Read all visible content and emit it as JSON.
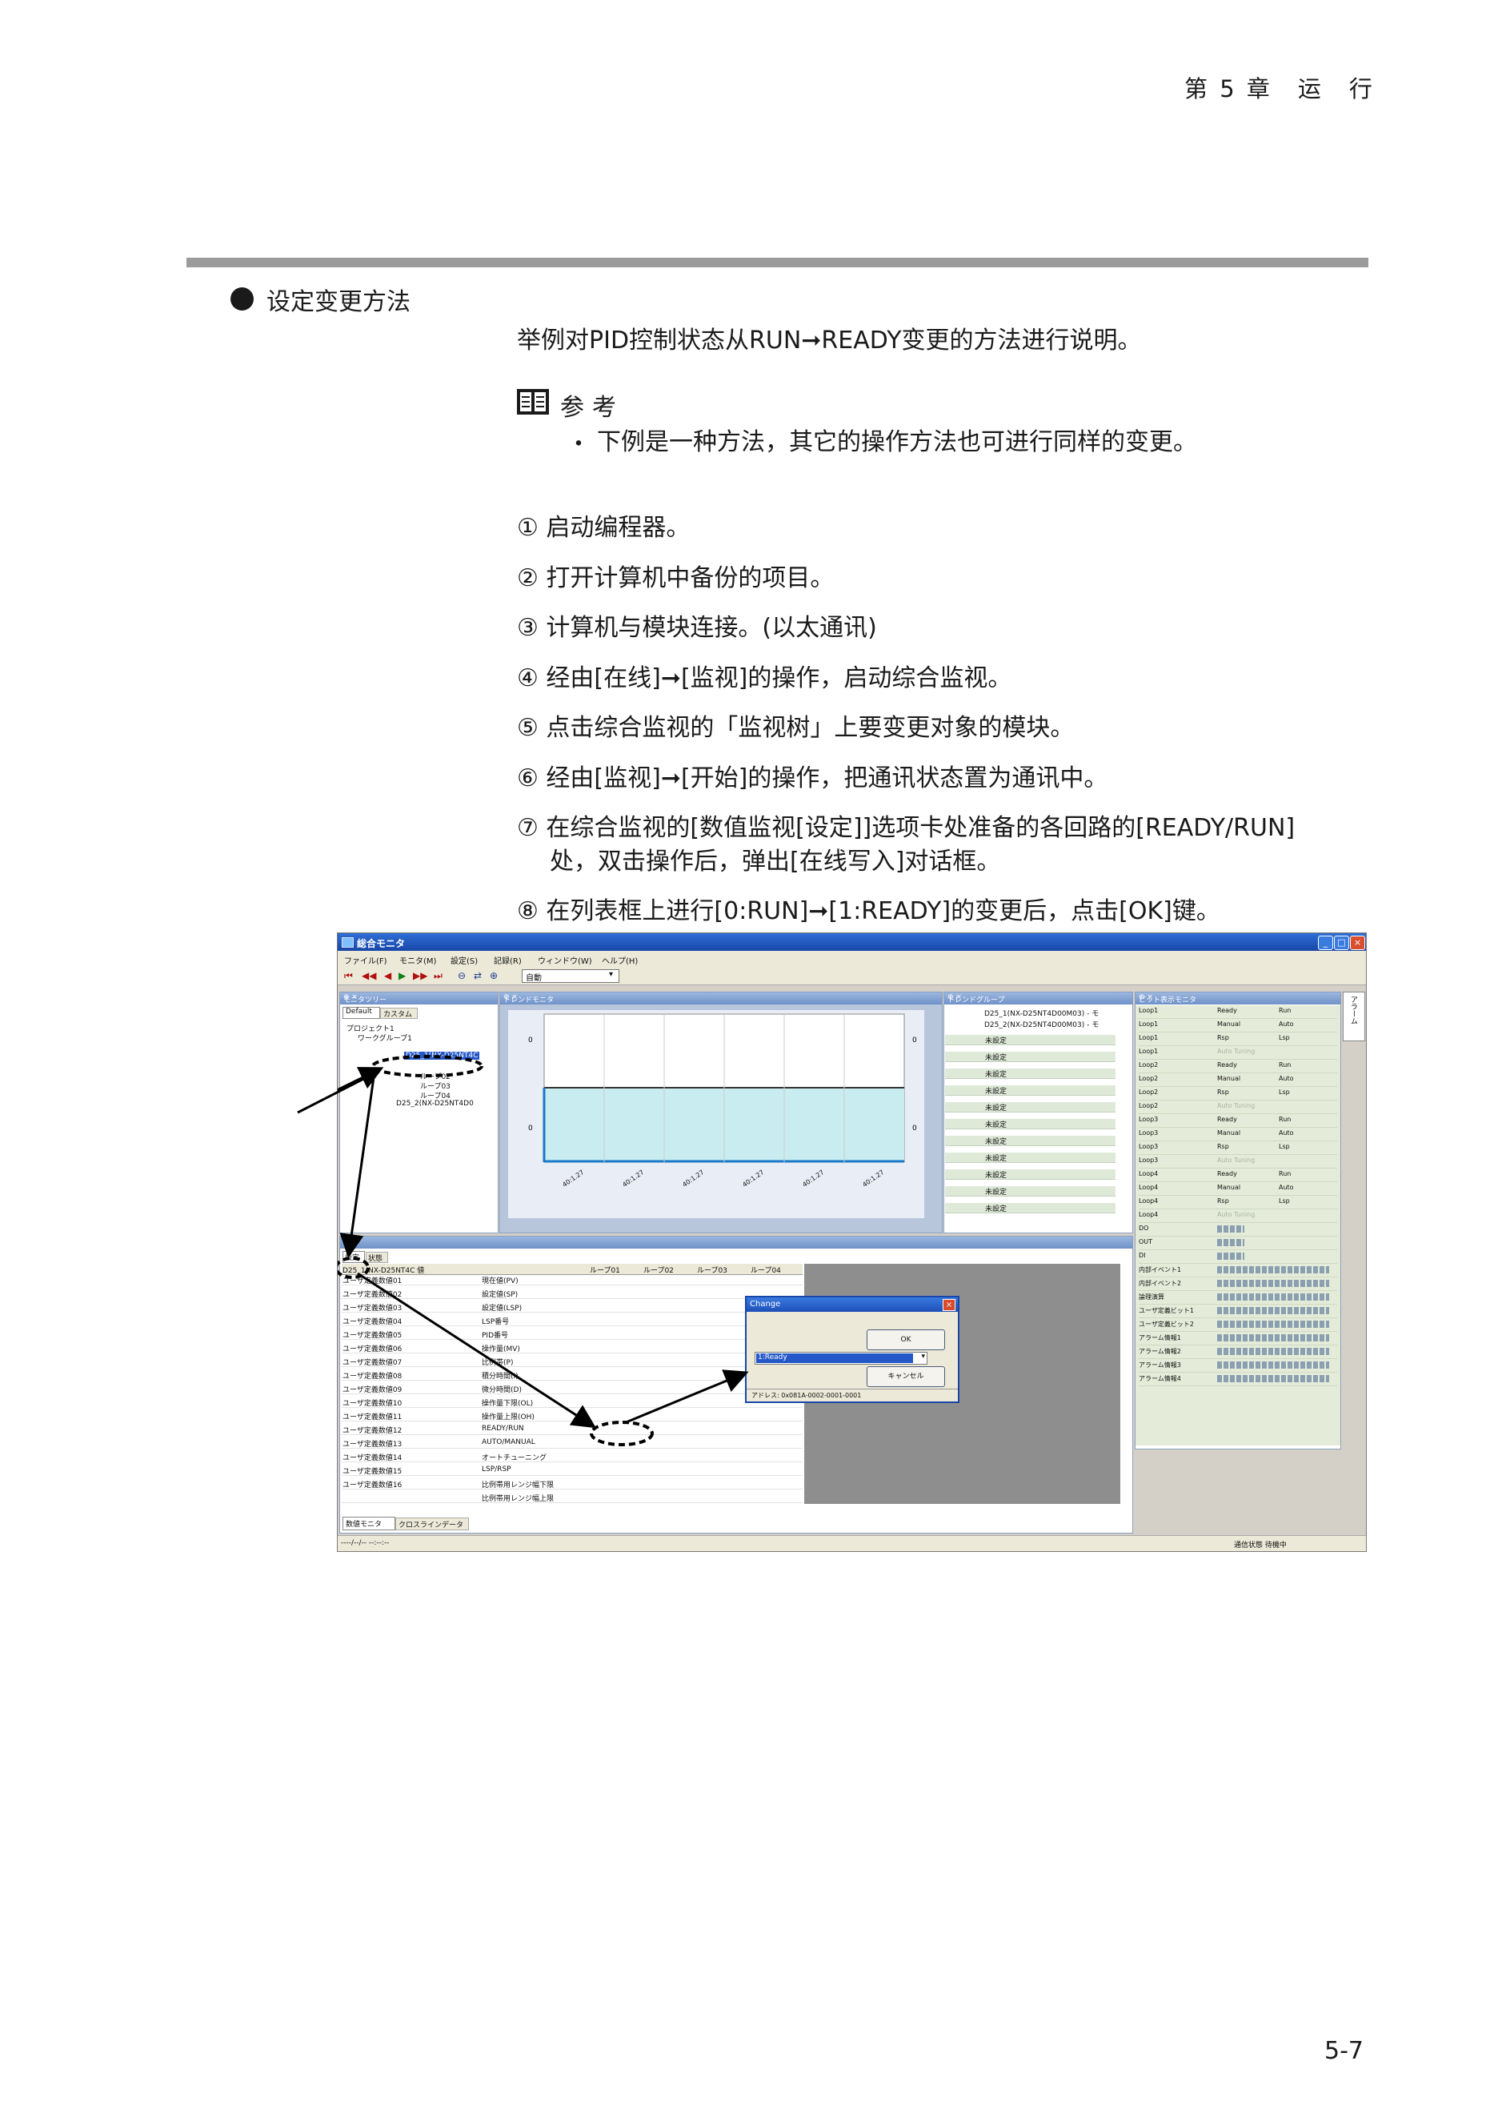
{
  "header": {
    "chapter": "第 5 章　运　行"
  },
  "section": {
    "title": "设定变更方法",
    "intro": "举例对PID控制状态从RUN➞READY变更的方法进行说明。"
  },
  "reference": {
    "title": "参考",
    "bullet": "・",
    "text": "下例是一种方法，其它的操作方法也可进行同样的变更。"
  },
  "steps": [
    "① 启动编程器。",
    "② 打开计算机中备份的项目。",
    "③ 计算机与模块连接。(以太通讯)",
    "④ 经由[在线]➞[监视]的操作，启动综合监视。",
    "⑤ 点击综合监视的「监视树」上要变更对象的模块。",
    "⑥ 经由[监视]➞[开始]的操作，把通讯状态置为通讯中。",
    "⑦ 在综合监视的[数值监视[设定]]选项卡处准备的各回路的[READY/RUN]",
    "处，双击操作后，弹出[在线写入]对话框。",
    "⑧ 在列表框上进行[0:RUN]➞[1:READY]的变更后，点击[OK]键。"
  ],
  "page_number": "5-7",
  "app": {
    "title": "総合モニタ",
    "menu": [
      "ファイル(F)",
      "モニタ(M)",
      "設定(S)",
      "記録(R)",
      "ウィンドウ(W)",
      "ヘルプ(H)"
    ],
    "toolbar_combo": "自動",
    "tree_panel": {
      "title": "モニタツリー",
      "tabs": [
        "Default",
        "カスタム"
      ],
      "nodes": [
        "プロジェクト1",
        "ワークグループ1",
        "D25_1(NX-D25NT4C",
        "ループ02",
        "ループ03",
        "ループ04",
        "D25_2(NX-D25NT4D0"
      ]
    },
    "trend_panel": {
      "title": "トレンドモニタ",
      "times": [
        "40:1.27",
        "40:1.27",
        "40:1.27",
        "40:1.27",
        "40:1.27",
        "40:1.27"
      ]
    },
    "trend_group_panel": {
      "title": "トレンドグループ",
      "groups": [
        "D25_1(NX-D25NT4D00M03) - モ",
        "D25_2(NX-D25NT4D00M03) - モ"
      ],
      "unset_label": "未設定",
      "unset_count": 11
    },
    "bit_panel": {
      "title": "ビット表示モニタ",
      "rows": [
        [
          "Loop1",
          "Ready",
          "Run"
        ],
        [
          "Loop1",
          "Manual",
          "Auto"
        ],
        [
          "Loop1",
          "Rsp",
          "Lsp"
        ],
        [
          "Loop1",
          "Auto Tuning",
          ""
        ],
        [
          "Loop2",
          "Ready",
          "Run"
        ],
        [
          "Loop2",
          "Manual",
          "Auto"
        ],
        [
          "Loop2",
          "Rsp",
          "Lsp"
        ],
        [
          "Loop2",
          "Auto Tuning",
          ""
        ],
        [
          "Loop3",
          "Ready",
          "Run"
        ],
        [
          "Loop3",
          "Manual",
          "Auto"
        ],
        [
          "Loop3",
          "Rsp",
          "Lsp"
        ],
        [
          "Loop3",
          "Auto Tuning",
          ""
        ],
        [
          "Loop4",
          "Ready",
          "Run"
        ],
        [
          "Loop4",
          "Manual",
          "Auto"
        ],
        [
          "Loop4",
          "Rsp",
          "Lsp"
        ],
        [
          "Loop4",
          "Auto Tuning",
          ""
        ],
        [
          "DO",
          "",
          ""
        ],
        [
          "OUT",
          "",
          ""
        ],
        [
          "DI",
          "",
          ""
        ],
        [
          "内部イベント1",
          "",
          ""
        ],
        [
          "内部イベント2",
          "",
          ""
        ],
        [
          "論理演算",
          "",
          ""
        ],
        [
          "ユーザ定義ビット1",
          "",
          ""
        ],
        [
          "ユーザ定義ビット2",
          "",
          ""
        ],
        [
          "アラーム情報1",
          "",
          ""
        ],
        [
          "アラーム情報2",
          "",
          ""
        ],
        [
          "アラーム情報3",
          "",
          ""
        ],
        [
          "アラーム情報4",
          "",
          ""
        ]
      ]
    },
    "side_tab": "アラーム",
    "data_panel": {
      "tabs": [
        "設定",
        "状態"
      ],
      "header": [
        "D25_1(NX-D25NT4C 値",
        "ループ01",
        "ループ02",
        "ループ03",
        "ループ04"
      ],
      "rows": [
        [
          "ユーザ定義数値01",
          "現在値(PV)"
        ],
        [
          "ユーザ定義数値02",
          "設定値(SP)"
        ],
        [
          "ユーザ定義数値03",
          "設定値(LSP)"
        ],
        [
          "ユーザ定義数値04",
          "LSP番号"
        ],
        [
          "ユーザ定義数値05",
          "PID番号"
        ],
        [
          "ユーザ定義数値06",
          "操作量(MV)"
        ],
        [
          "ユーザ定義数値07",
          "比例帯(P)"
        ],
        [
          "ユーザ定義数値08",
          "積分時間(I)"
        ],
        [
          "ユーザ定義数値09",
          "微分時間(D)"
        ],
        [
          "ユーザ定義数値10",
          "操作量下限(OL)"
        ],
        [
          "ユーザ定義数値11",
          "操作量上限(OH)"
        ],
        [
          "ユーザ定義数値12",
          "READY/RUN"
        ],
        [
          "ユーザ定義数値13",
          "AUTO/MANUAL"
        ],
        [
          "ユーザ定義数値14",
          "オートチューニング"
        ],
        [
          "ユーザ定義数値15",
          "LSP/RSP"
        ],
        [
          "ユーザ定義数値16",
          "比例帯用レンジ幅下限"
        ],
        [
          "",
          "比例帯用レンジ幅上限"
        ]
      ],
      "bottom_tabs": [
        "数値モニタ",
        "クロスラインデータ"
      ]
    },
    "dialog": {
      "title": "Change",
      "selected": "1:Ready",
      "ok": "OK",
      "cancel": "キャンセル",
      "address": "アドレス: 0x081A-0002-0001-0001"
    },
    "status": {
      "left": "----/--/-- --:--:--",
      "right": "通信状態 待機中"
    }
  }
}
